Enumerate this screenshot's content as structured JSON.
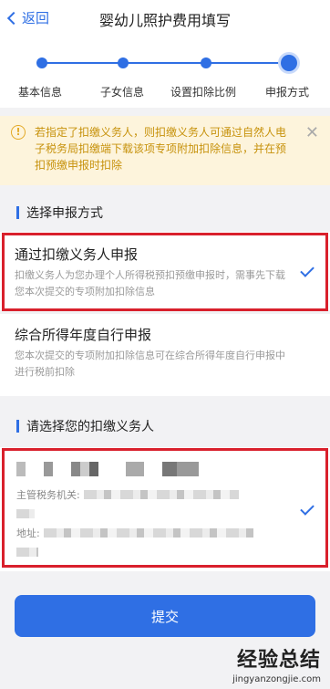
{
  "header": {
    "back_label": "返回",
    "title": "婴幼儿照护费用填写"
  },
  "steps": [
    "基本信息",
    "子女信息",
    "设置扣除比例",
    "申报方式"
  ],
  "notice": {
    "text": "若指定了扣缴义务人，则扣缴义务人可通过自然人电子税务局扣缴端下载该项专项附加扣除信息，并在预扣预缴申报时扣除"
  },
  "section1": {
    "title": "选择申报方式"
  },
  "options": [
    {
      "title": "通过扣缴义务人申报",
      "desc": "扣缴义务人为您办理个人所得税预扣预缴申报时，需事先下载您本次提交的专项附加扣除信息",
      "selected": true
    },
    {
      "title": "综合所得年度自行申报",
      "desc": "您本次提交的专项附加扣除信息可在综合所得年度自行申报中进行税前扣除",
      "selected": false
    }
  ],
  "section2": {
    "title": "请选择您的扣缴义务人"
  },
  "agent": {
    "tax_office_label": "主管税务机关:",
    "address_label": "地址:"
  },
  "submit_label": "提交",
  "watermark": {
    "line1": "经验总结",
    "line2": "jingyanzongjie.com"
  },
  "colors": {
    "accent": "#2f6fe4",
    "highlight_border": "#d9202c",
    "notice_bg": "#fdf4dc"
  }
}
